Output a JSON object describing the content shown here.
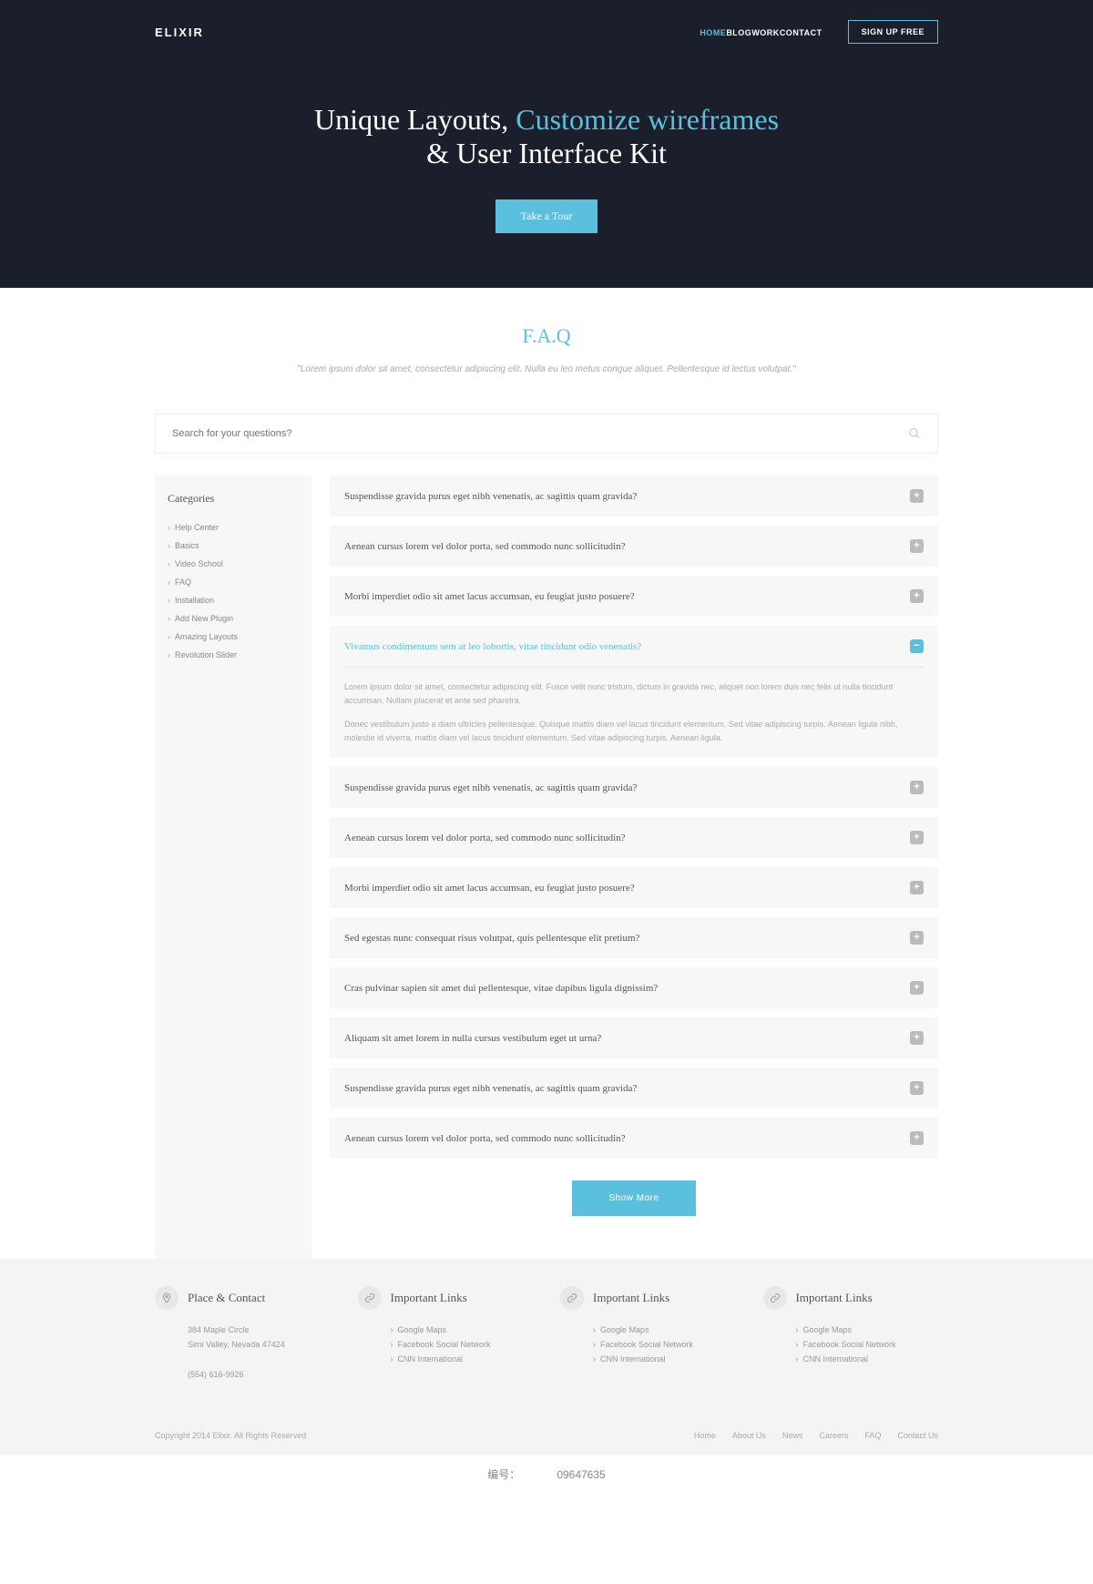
{
  "nav": {
    "logo": "ELIXIR",
    "items": [
      {
        "label": "HOME",
        "active": true
      },
      {
        "label": "BLOG",
        "active": false
      },
      {
        "label": "WORK",
        "active": false
      },
      {
        "label": "CONTACT",
        "active": false
      }
    ],
    "signup": "SIGN UP FREE"
  },
  "hero": {
    "title_1": "Unique Layouts, ",
    "title_hl": "Customize wireframes",
    "title_2": "& User Interface Kit",
    "cta": "Take a Tour"
  },
  "faq": {
    "title": "F.A.Q",
    "sub": "\"Lorem ipsum dolor sit amet, consectetur adipiscing elit. Nulla eu leo metus congue aliquet. Pellentesque id lectus volutpat.\"",
    "search_placeholder": "Search for your questions?"
  },
  "sidebar": {
    "title": "Categories",
    "items": [
      "Help Center",
      "Basics",
      "Video School",
      "FAQ",
      "Installation",
      "Add New Plugin",
      "Amazing Layouts",
      "Revolution Slider"
    ]
  },
  "accordion": [
    {
      "q": "Suspendisse gravida purus eget nibh venenatis, ac sagittis quam gravida?"
    },
    {
      "q": "Aenean cursus lorem vel dolor porta, sed commodo nunc sollicitudin?"
    },
    {
      "q": "Morbi imperdiet odio sit amet lacus accumsan, eu feugiat justo posuere?"
    },
    {
      "q": "Vivamus condimentum sem at leo lobortis, vitae tincidunt odio venenatis?",
      "open": true,
      "a1": "Lorem ipsum dolor sit amet, consectetur adipiscing elit. Fusce velit nunc tristum, dictum in gravida nec, aliquet non lorem duis nec felis ut nulla tincidunt accumsan. Nullam placerat et ante sed pharetra.",
      "a2": "Donec vestibulum justo a diam ultricies pellentesque. Quisque mattis diam vel lacus tincidunt elementum. Sed vitae adipiscing turpis. Aenean ligula nibh, molestie id viverra. mattis diam vel lacus tincidunt elementum. Sed vitae adipiscing turpis. Aenean ligula."
    },
    {
      "q": "Suspendisse gravida purus eget nibh venenatis, ac sagittis quam gravida?"
    },
    {
      "q": "Aenean cursus lorem vel dolor porta, sed commodo nunc sollicitudin?"
    },
    {
      "q": "Morbi imperdiet odio sit amet lacus accumsan, eu feugiat justo posuere?"
    },
    {
      "q": "Sed egestas nunc consequat risus volutpat, quis pellentesque elit pretium?"
    },
    {
      "q": "Cras pulvinar sapien sit amet dui pellentesque, vitae dapibus ligula dignissim?"
    },
    {
      "q": "Aliquam sit amet lorem in nulla cursus vestibulum eget ut urna?"
    },
    {
      "q": "Suspendisse gravida purus eget nibh venenatis, ac sagittis quam gravida?"
    },
    {
      "q": "Aenean cursus lorem vel dolor porta, sed commodo nunc sollicitudin?"
    }
  ],
  "show_more": "Show More",
  "footer": {
    "cols": [
      {
        "title": "Place & Contact",
        "type": "address",
        "lines": [
          "384 Maple Circle",
          "Simi Valley, Nevada 47424",
          "",
          "(554) 616-9926"
        ]
      },
      {
        "title": "Important Links",
        "type": "links",
        "links": [
          "Google Maps",
          "Facebook Social Network",
          "CNN International"
        ]
      },
      {
        "title": "Important Links",
        "type": "links",
        "links": [
          "Google Maps",
          "Facebook Social Network",
          "CNN International"
        ]
      },
      {
        "title": "Important Links",
        "type": "links",
        "links": [
          "Google Maps",
          "Facebook Social Network",
          "CNN International"
        ]
      }
    ],
    "copyright": "Copyright 2014 Elixir. All Rights Reserved",
    "links": [
      "Home",
      "About Us",
      "News",
      "Careers",
      "FAQ",
      "Contact Us"
    ]
  },
  "meta": {
    "id_label": "编号：",
    "id": "09647635"
  }
}
